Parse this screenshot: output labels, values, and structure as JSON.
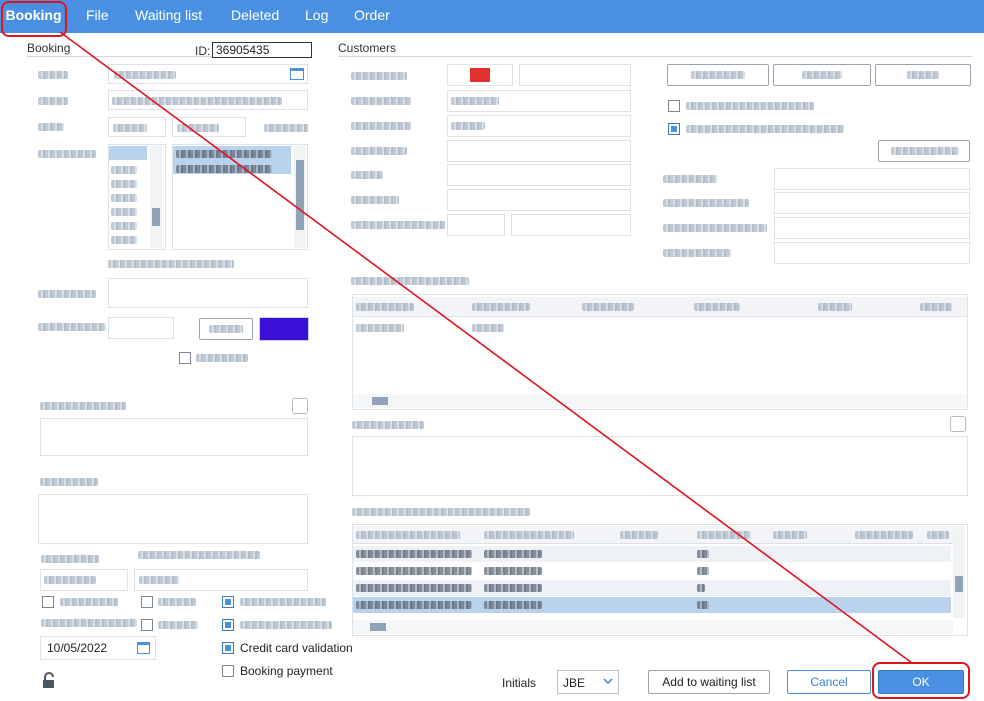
{
  "menu": {
    "items": [
      "Booking",
      "File",
      "Waiting list",
      "Deleted",
      "Log",
      "Order"
    ]
  },
  "booking": {
    "section_title": "Booking",
    "id_label": "ID:",
    "id_value": "36905435",
    "order_date_value": "10/05/2022",
    "credit_card_label": "Credit card validation",
    "booking_payment_label": "Booking payment",
    "credit_card_checked": true,
    "booking_payment_checked": false
  },
  "customers": {
    "section_title": "Customers"
  },
  "footer": {
    "initials_label": "Initials",
    "initials_value": "JBE",
    "add_waiting_label": "Add to waiting list",
    "cancel_label": "Cancel",
    "ok_label": "OK"
  },
  "colors": {
    "accent": "#4a90e2",
    "annotation": "#e0141e",
    "color_swatch": "#3a0fd6"
  },
  "icons": {
    "calendar": "calendar-icon",
    "lock": "lock-icon",
    "dropdown": "chevron-down-icon"
  }
}
